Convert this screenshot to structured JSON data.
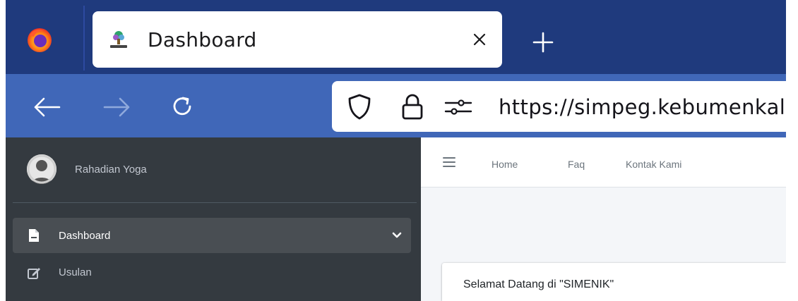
{
  "browser": {
    "tab": {
      "title": "Dashboard"
    },
    "address_bar": {
      "url": "https://simpeg.kebumenkal"
    },
    "icons": {
      "browser_logo": "firefox-logo-icon",
      "favicon": "simenik-favicon-icon",
      "close": "close-icon",
      "new_tab": "plus-icon",
      "back": "arrow-left-icon",
      "forward": "arrow-right-icon",
      "reload": "reload-icon",
      "tracking": "shield-icon",
      "secure": "lock-icon",
      "permissions": "permissions-icon"
    },
    "colors": {
      "tab_strip": "#1f3a7d",
      "toolbar": "#4067b8"
    }
  },
  "sidebar": {
    "user": {
      "name": "Rahadian Yoga"
    },
    "items": [
      {
        "label": "Dashboard",
        "icon": "file-icon",
        "active": true,
        "has_caret": true
      },
      {
        "label": "Usulan",
        "icon": "edit-icon",
        "active": false
      }
    ],
    "colors": {
      "background": "#343a40",
      "active": "#494e53",
      "text": "#c2c7d0"
    }
  },
  "topnav": {
    "menu_icon": "hamburger-icon",
    "links": [
      {
        "label": "Home"
      },
      {
        "label": "Faq"
      },
      {
        "label": "Kontak Kami"
      }
    ]
  },
  "main": {
    "card_title": "Selamat Datang di \"SIMENIK\""
  }
}
